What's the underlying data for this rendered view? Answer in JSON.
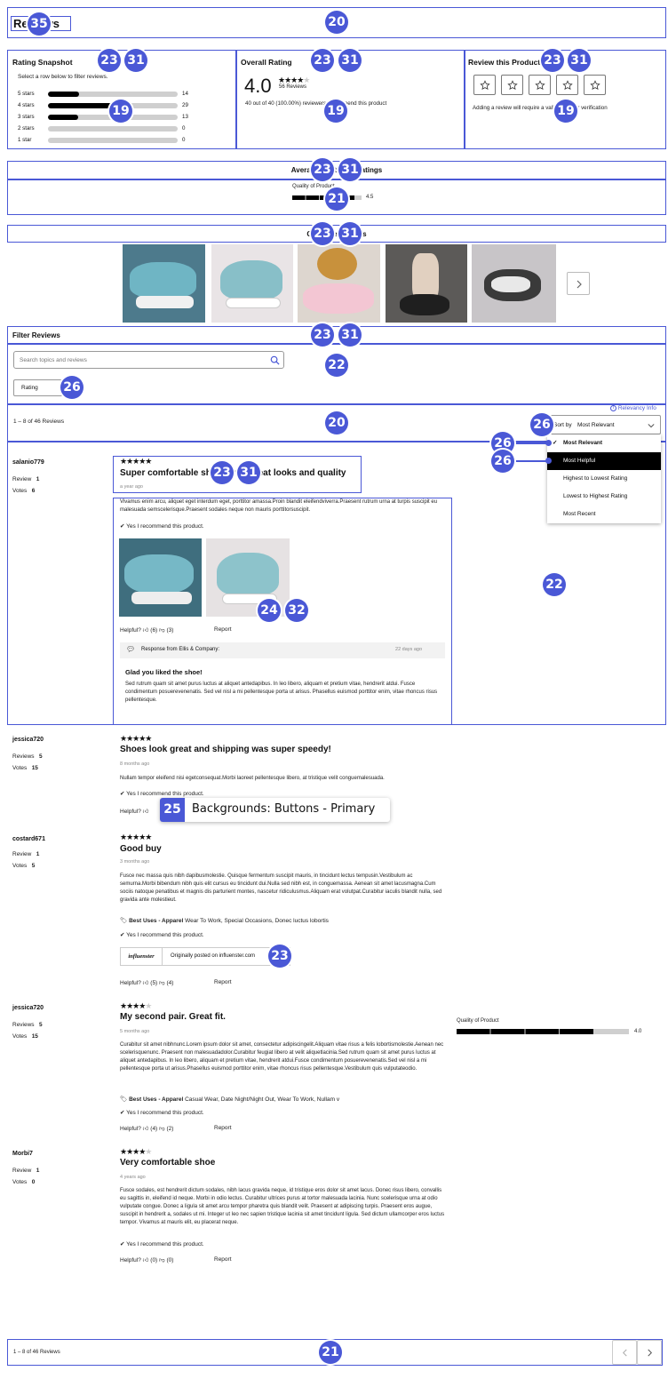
{
  "header": {
    "title": "Reviews"
  },
  "snapshot": {
    "title": "Rating Snapshot",
    "hint": "Select a row below to filter reviews.",
    "rows": [
      {
        "label": "5 stars",
        "count": "14",
        "fraction": 0.24
      },
      {
        "label": "4 stars",
        "count": "29",
        "fraction": 0.5
      },
      {
        "label": "3 stars",
        "count": "13",
        "fraction": 0.23
      },
      {
        "label": "2 stars",
        "count": "0",
        "fraction": 0
      },
      {
        "label": "1 star",
        "count": "0",
        "fraction": 0
      }
    ]
  },
  "overall": {
    "title": "Overall Rating",
    "value": "4.0",
    "stars": "★★★★",
    "star_empty": "★",
    "count": "56 Reviews",
    "recommend": "40 out of 40 (100.00%) reviewers recommend this product"
  },
  "review_product": {
    "title": "Review this Product",
    "note": "Adding a review will require a valid email for verification"
  },
  "averages": {
    "title": "Average Customer Ratings",
    "label": "Quality of Product",
    "value": "4.5",
    "fraction": 0.9
  },
  "images": {
    "title": "Customer Images"
  },
  "filter": {
    "title": "Filter Reviews",
    "placeholder": "Search topics and reviews",
    "rating_label": "Rating"
  },
  "toolbar": {
    "count": "1 – 8 of 46 Reviews",
    "relevancy": "Relevancy Info",
    "sort_prefix": "Sort by",
    "sort_value": "Most Relevant",
    "options": [
      "Most Relevant",
      "Most Helpful",
      "Highest to Lowest Rating",
      "Lowest to Highest Rating",
      "Most Recent"
    ]
  },
  "reviews": [
    {
      "user": "salanio779",
      "reviews_label": "Review",
      "reviews": "1",
      "votes_label": "Votes",
      "votes": "6",
      "stars": "★★★★★",
      "title": "Super comfortable shoes with great looks and quality",
      "date": "a year ago",
      "body": "Vivamus enim arcu, aliquet eget interdum eget, porttitor amassa.Proin blandit eleifendviverra.Praesent rutrum urna at turpis suscipit eu malesuada semscelerisque.Praesent sodales neque non mauris porttitorsuscipit.",
      "recommend": "Yes I recommend this product.",
      "helpful": "Helpful?",
      "up": "(6)",
      "down": "(3)",
      "report": "Report",
      "response": {
        "from": "Response from Ellis & Company:",
        "date": "22 days ago",
        "title": "Glad you liked the shoe!",
        "body": "Sed rutrum quam sit amet purus luctus at aliquet antedapibus. In leo libero, aliquam et pretium vitae, hendrerit atdui. Fusce condimentum posuerevenenatis. Sed vel nisl a mi pellentesque porta ut arisus. Phasellus euismod porttitor enim, vitae rhoncus risus pellentesque."
      }
    },
    {
      "user": "jessica720",
      "reviews_label": "Reviews",
      "reviews": "5",
      "votes_label": "Votes",
      "votes": "15",
      "stars": "★★★★★",
      "title": "Shoes look great and shipping was super speedy!",
      "date": "8 months ago",
      "body": "Nullam tempor eleifend nisi egetconsequat.Morbi laoreet pellentesque libero, at tristique velit conguemalesuada.",
      "recommend": "Yes I recommend this product.",
      "helpful": "Helpful?"
    },
    {
      "user": "costard671",
      "reviews_label": "Review",
      "reviews": "1",
      "votes_label": "Votes",
      "votes": "5",
      "stars": "★★★★★",
      "title": "Good buy",
      "date": "3 months ago",
      "body": "Fusce nec massa quis nibh dapibusmolestie. Quisque fermentum suscipit mauris, in tincidunt lectus tempusin.Vestibulum ac semurna.Morbi bibendum nibh quis elit cursus eu tincidunt dui.Nulla sed nibh est, in conguemassa. Aenean sit amet lacusmagna.Cum sociis natoque penatibus et magnis dis parturient montes, nascetur ridiculusmus.Aliquam erat volutpat.Curabitur iaculis blandit nulla, sed gravida ante molestieut.",
      "uses_label": "Best Uses - Apparel",
      "uses": "Wear To Work, Special Occasions, Donec luctus lobortis",
      "recommend": "Yes I recommend this product.",
      "source_logo": "influenster",
      "source": "Originally posted on influenster.com",
      "helpful": "Helpful?",
      "up": "(5)",
      "down": "(4)",
      "report": "Report"
    },
    {
      "user": "jessica720",
      "reviews_label": "Reviews",
      "reviews": "5",
      "votes_label": "Votes",
      "votes": "15",
      "stars": "★★★★",
      "star_empty": "★",
      "title": "My second pair. Great fit.",
      "date": "5 months ago",
      "body": "Curabitur sit amet nibhnunc.Lorem ipsum dolor sit amet, consectetur adipiscingelit.Aliquam vitae risus a felis lobortismolestie.Aenean nec scelerisquenunc. Praesent non malesuadadolor.Curabitur feugiat libero at velit aliquetlacinia.Sed rutrum quam sit amet purus luctus at aliquet antedapibus. In leo libero, aliquam et pretium vitae, hendrerit atdui.Fusce condimentum posuerevenenatis.Sed vel nisl a mi pellentesque porta ut arisus.Phasellus euismod porttitor enim, vitae rhoncus risus pellentesque.Vestibulum quis vulputateodio.",
      "uses_label": "Best Uses - Apparel",
      "uses": "Casual Wear, Date Night/Night Out, Wear To Work, Nullam v",
      "recommend": "Yes I recommend this product.",
      "helpful": "Helpful?",
      "up": "(4)",
      "down": "(2)",
      "report": "Report",
      "quality_label": "Quality of Product",
      "quality_value": "4.0",
      "quality_fraction": 0.8
    },
    {
      "user": "Morbi7",
      "reviews_label": "Review",
      "reviews": "1",
      "votes_label": "Votes",
      "votes": "0",
      "stars": "★★★★",
      "star_empty": "★",
      "title": "Very comfortable shoe",
      "date": "4 years ago",
      "body": "Fusce sodales, est hendrerit dictum sodales, nibh lacus gravida neque, id tristique eros dolor sit amet lacus. Donec risus libero, convallis eu sagittis in, eleifend id neque. Morbi in odio lectus. Curabitur ultrices purus at tortor malesuada lacinia. Nunc scelerisque urna at odio vulputate congue. Donec a ligula sit amet arcu tempor pharetra quis blandit velit. Praesent at adipiscing turpis. Praesent eros augue, suscipit in hendrerit a, sodales ut mi. Integer ut leo nec sapien tristique lacinia sit amet tincidunt ligula. Sed dictum ullamcorper eros luctus tempor. Vivamus at mauris elit, eu placerat neque.",
      "recommend": "Yes I recommend this product.",
      "helpful": "Helpful?",
      "up": "(0)",
      "down": "(0)",
      "report": "Report"
    }
  ],
  "footer": {
    "count": "1 – 8 of 46 Reviews"
  },
  "tooltip": {
    "number": "25",
    "text": "Backgrounds: Buttons - Primary"
  },
  "badges": [
    "35",
    "20",
    "23",
    "31",
    "19",
    "21",
    "22",
    "26",
    "24",
    "32"
  ],
  "colors": {
    "annotation": "#4a58d6",
    "bar_fill": "#000000",
    "bar_track": "#cfcfcf"
  }
}
